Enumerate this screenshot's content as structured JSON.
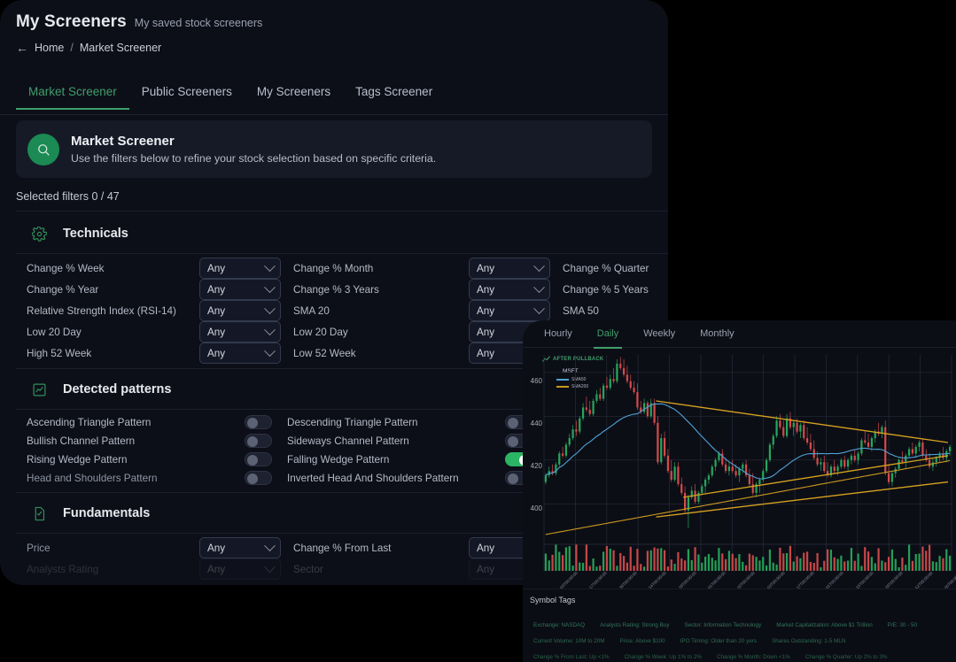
{
  "header": {
    "title": "My Screeners",
    "subtitle": "My saved stock screeners",
    "back_icon": "arrow-left-icon",
    "breadcrumb": {
      "home": "Home",
      "separator": "/",
      "current": "Market Screener"
    }
  },
  "tabs": [
    {
      "label": "Market Screener",
      "active": true
    },
    {
      "label": "Public Screeners",
      "active": false
    },
    {
      "label": "My Screeners",
      "active": false
    },
    {
      "label": "Tags Screener",
      "active": false
    }
  ],
  "hero": {
    "icon": "search-circle-icon",
    "title": "Market Screener",
    "description": "Use the filters below to refine your stock selection based on specific criteria.",
    "accent_color": "#1b8a54"
  },
  "selected_filters": "Selected filters 0 / 47",
  "sections": [
    {
      "id": "technicals",
      "icon": "gear-icon",
      "title": "Technicals",
      "rows": [
        {
          "left_label": "Change % Week",
          "left_value": "Any",
          "mid_label": "Change % Month",
          "mid_value": "Any",
          "right_label": "Change % Quarter"
        },
        {
          "left_label": "Change % Year",
          "left_value": "Any",
          "mid_label": "Change % 3 Years",
          "mid_value": "Any",
          "right_label": "Change % 5 Years"
        },
        {
          "left_label": "Relative Strength Index (RSI-14)",
          "left_value": "Any",
          "mid_label": "SMA 20",
          "mid_value": "Any",
          "right_label": "SMA 50"
        },
        {
          "left_label": "Low 20 Day",
          "left_value": "Any",
          "mid_label": "Low 20 Day",
          "mid_value": "Any",
          "right_label": ""
        },
        {
          "left_label": "High 52 Week",
          "left_value": "Any",
          "mid_label": "Low 52 Week",
          "mid_value": "Any",
          "right_label": ""
        }
      ]
    },
    {
      "id": "detected-patterns",
      "icon": "chart-line-icon",
      "title": "Detected patterns",
      "rows": [
        {
          "left_label": "Ascending Triangle Pattern",
          "left_on": false,
          "mid_label": "Descending Triangle Pattern",
          "mid_on": false
        },
        {
          "left_label": "Bullish Channel Pattern",
          "left_on": false,
          "mid_label": "Sideways Channel Pattern",
          "mid_on": false
        },
        {
          "left_label": "Rising Wedge Pattern",
          "left_on": false,
          "mid_label": "Falling Wedge Pattern",
          "mid_on": true
        },
        {
          "left_label": "Head and Shoulders Pattern",
          "left_on": false,
          "mid_label": "Inverted Head And Shoulders Pattern",
          "mid_on": false
        }
      ]
    },
    {
      "id": "fundamentals",
      "icon": "document-check-icon",
      "title": "Fundamentals",
      "rows": [
        {
          "left_label": "Price",
          "left_value": "Any",
          "mid_label": "Change % From Last",
          "mid_value": "Any",
          "right_label": ""
        }
      ]
    }
  ],
  "chart_panel": {
    "tabs": [
      {
        "label": "Hourly",
        "active": false
      },
      {
        "label": "Daily",
        "active": true
      },
      {
        "label": "Weekly",
        "active": false
      },
      {
        "label": "Monthly",
        "active": false
      }
    ],
    "pattern_badge": "AFTER PULLBACK",
    "ticker": "MSFT",
    "legend": [
      {
        "name": "SMA50",
        "color": "#4ea3d6"
      },
      {
        "name": "SMA200",
        "color": "#c9971f"
      }
    ],
    "y_ticks": [
      "460",
      "440",
      "420",
      "400"
    ],
    "x_labels": [
      "2024-06-03T00:00:00",
      "2024-06-17T00:00:00",
      "2024-06-30T00:00:00",
      "2024-07-14T00:00:00",
      "2024-07-29T00:00:00",
      "2024-08-01T00:00:00",
      "2024-08-20T00:00:00",
      "2024-09-03T00:00:00",
      "2024-09-17T00:00:00",
      "2024-10-01T00:00:00",
      "2024-10-15T00:00:00",
      "2024-10-29T00:00:00",
      "2024-11-12T00:00:00",
      "2024-11-26T00:00:00"
    ]
  },
  "symbol_tags": {
    "title": "Symbol Tags",
    "rows": [
      [
        "Exchange: NASDAQ",
        "Analysts Rating: Strong Buy",
        "Sector: Information Technology",
        "Market Capitalization: Above $1 Trillion",
        "P/E: 30 - 50"
      ],
      [
        "Current Volume: 10M to 20M",
        "Price: Above $100",
        "IPO Timing: Older than 20 yers",
        "Shares Outstanding: 1-5 MLN"
      ],
      [
        "Change % From Last: Up <1%",
        "Change % Week: Up 1% to 2%",
        "Change % Month: Down <1%",
        "Change % Quarter: Up 2% to 3%"
      ]
    ]
  },
  "chart_data": {
    "type": "candlestick",
    "title": "MSFT",
    "ylim": [
      388,
      468
    ],
    "yticks": [
      400,
      420,
      440,
      460
    ],
    "series": [
      {
        "name": "SMA50",
        "color": "#4ea3d6"
      },
      {
        "name": "SMA200",
        "color": "#c9971f"
      }
    ],
    "up_color": "#26a65b",
    "down_color": "#d14b4b",
    "trendlines": [
      {
        "name": "falling-wedge-upper",
        "color": "#c9971f"
      },
      {
        "name": "falling-wedge-lower",
        "color": "#c9971f"
      }
    ],
    "candles": [
      [
        410,
        414,
        409,
        413
      ],
      [
        413,
        417,
        412,
        415
      ],
      [
        415,
        418,
        413,
        414
      ],
      [
        414,
        419,
        413,
        418
      ],
      [
        418,
        424,
        417,
        423
      ],
      [
        423,
        426,
        421,
        422
      ],
      [
        422,
        428,
        421,
        427
      ],
      [
        427,
        432,
        426,
        430
      ],
      [
        430,
        436,
        429,
        434
      ],
      [
        434,
        438,
        431,
        433
      ],
      [
        433,
        440,
        432,
        439
      ],
      [
        439,
        446,
        438,
        444
      ],
      [
        444,
        449,
        442,
        443
      ],
      [
        443,
        447,
        440,
        441
      ],
      [
        441,
        448,
        440,
        447
      ],
      [
        447,
        452,
        446,
        450
      ],
      [
        450,
        453,
        447,
        448
      ],
      [
        448,
        455,
        447,
        454
      ],
      [
        454,
        458,
        452,
        453
      ],
      [
        453,
        459,
        452,
        457
      ],
      [
        457,
        462,
        455,
        456
      ],
      [
        456,
        466,
        455,
        464
      ],
      [
        464,
        467,
        461,
        462
      ],
      [
        462,
        466,
        458,
        459
      ],
      [
        459,
        463,
        455,
        456
      ],
      [
        456,
        459,
        452,
        453
      ],
      [
        453,
        456,
        450,
        451
      ],
      [
        451,
        455,
        443,
        444
      ],
      [
        444,
        447,
        441,
        442
      ],
      [
        442,
        448,
        441,
        446
      ],
      [
        446,
        447,
        439,
        440
      ],
      [
        440,
        448,
        439,
        446
      ],
      [
        446,
        448,
        436,
        437
      ],
      [
        437,
        440,
        418,
        419
      ],
      [
        419,
        432,
        418,
        430
      ],
      [
        430,
        433,
        421,
        422
      ],
      [
        422,
        425,
        414,
        415
      ],
      [
        415,
        420,
        410,
        411
      ],
      [
        411,
        419,
        410,
        417
      ],
      [
        417,
        419,
        408,
        409
      ],
      [
        409,
        412,
        404,
        405
      ],
      [
        405,
        408,
        396,
        397
      ],
      [
        397,
        404,
        389,
        403
      ],
      [
        403,
        408,
        402,
        406
      ],
      [
        406,
        409,
        400,
        401
      ],
      [
        401,
        406,
        400,
        405
      ],
      [
        405,
        409,
        404,
        408
      ],
      [
        408,
        412,
        405,
        411
      ],
      [
        411,
        414,
        409,
        413
      ],
      [
        413,
        418,
        412,
        417
      ],
      [
        417,
        421,
        415,
        420
      ],
      [
        420,
        424,
        419,
        423
      ],
      [
        423,
        425,
        417,
        418
      ],
      [
        418,
        421,
        414,
        415
      ],
      [
        415,
        419,
        413,
        417
      ],
      [
        417,
        420,
        414,
        415
      ],
      [
        415,
        418,
        412,
        413
      ],
      [
        413,
        417,
        410,
        416
      ],
      [
        416,
        419,
        414,
        418
      ],
      [
        418,
        420,
        412,
        413
      ],
      [
        413,
        416,
        408,
        409
      ],
      [
        409,
        414,
        404,
        405
      ],
      [
        405,
        410,
        403,
        409
      ],
      [
        409,
        412,
        405,
        411
      ],
      [
        411,
        416,
        410,
        415
      ],
      [
        415,
        421,
        414,
        420
      ],
      [
        420,
        428,
        419,
        427
      ],
      [
        427,
        432,
        425,
        431
      ],
      [
        431,
        440,
        430,
        438
      ],
      [
        438,
        441,
        434,
        435
      ],
      [
        435,
        438,
        430,
        431
      ],
      [
        431,
        441,
        430,
        439
      ],
      [
        439,
        442,
        434,
        435
      ],
      [
        435,
        438,
        431,
        437
      ],
      [
        437,
        439,
        432,
        433
      ],
      [
        433,
        437,
        430,
        436
      ],
      [
        436,
        438,
        429,
        430
      ],
      [
        430,
        435,
        427,
        428
      ],
      [
        428,
        432,
        424,
        425
      ],
      [
        425,
        429,
        420,
        421
      ],
      [
        421,
        424,
        417,
        418
      ],
      [
        418,
        421,
        415,
        419
      ],
      [
        419,
        422,
        414,
        415
      ],
      [
        415,
        419,
        412,
        413
      ],
      [
        413,
        418,
        412,
        417
      ],
      [
        417,
        420,
        414,
        415
      ],
      [
        415,
        418,
        413,
        417
      ],
      [
        417,
        421,
        416,
        420
      ],
      [
        420,
        422,
        416,
        417
      ],
      [
        417,
        421,
        415,
        420
      ],
      [
        420,
        423,
        418,
        422
      ],
      [
        422,
        425,
        419,
        420
      ],
      [
        420,
        424,
        418,
        423
      ],
      [
        423,
        430,
        422,
        429
      ],
      [
        429,
        433,
        427,
        428
      ],
      [
        428,
        432,
        425,
        426
      ],
      [
        426,
        431,
        424,
        430
      ],
      [
        430,
        434,
        428,
        433
      ],
      [
        433,
        437,
        431,
        432
      ],
      [
        432,
        436,
        430,
        435
      ],
      [
        435,
        438,
        413,
        414
      ],
      [
        414,
        418,
        409,
        410
      ],
      [
        410,
        415,
        408,
        414
      ],
      [
        414,
        417,
        412,
        416
      ],
      [
        416,
        421,
        415,
        420
      ],
      [
        420,
        424,
        418,
        419
      ],
      [
        419,
        423,
        416,
        422
      ],
      [
        422,
        426,
        421,
        425
      ],
      [
        425,
        428,
        422,
        423
      ],
      [
        423,
        427,
        421,
        426
      ],
      [
        426,
        429,
        424,
        428
      ],
      [
        428,
        430,
        421,
        422
      ],
      [
        422,
        425,
        419,
        420
      ],
      [
        420,
        423,
        416,
        417
      ],
      [
        417,
        421,
        415,
        419
      ],
      [
        419,
        422,
        417,
        421
      ],
      [
        421,
        424,
        419,
        423
      ],
      [
        423,
        426,
        420,
        421
      ],
      [
        421,
        425,
        419,
        424
      ],
      [
        424,
        427,
        422,
        426
      ]
    ]
  }
}
